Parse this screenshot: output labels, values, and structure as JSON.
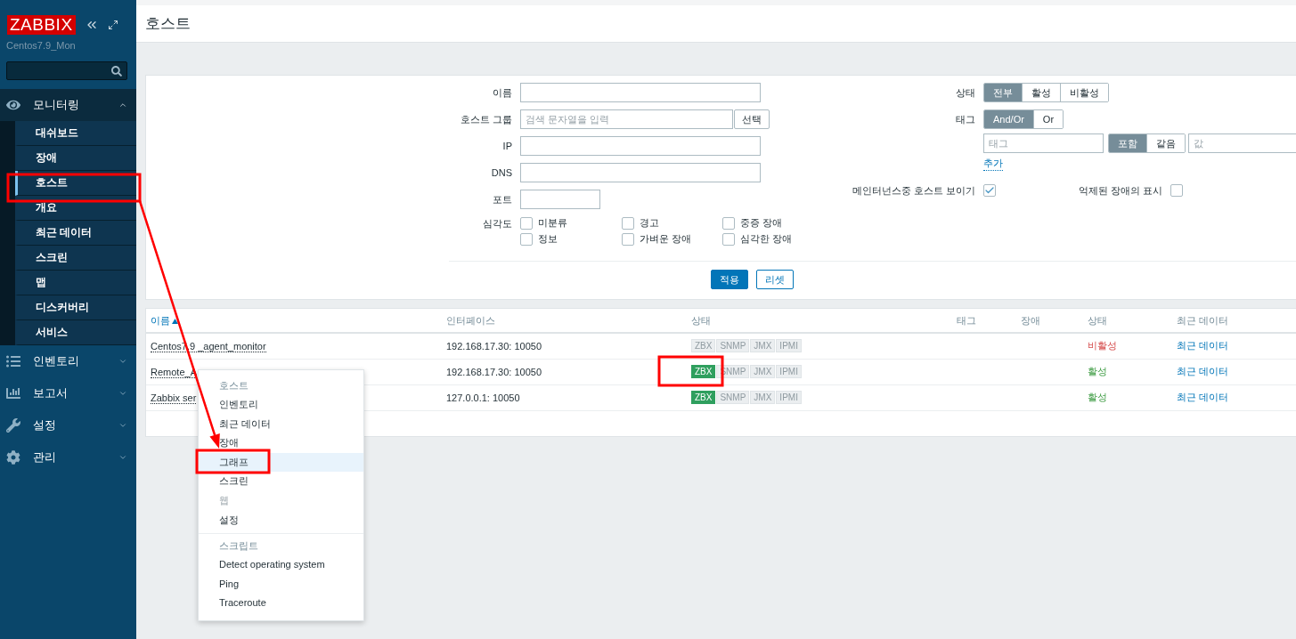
{
  "sidebar": {
    "logo": "ZABBIX",
    "server": "Centos7.9_Mon",
    "menu": [
      {
        "label": "모니터링",
        "expanded": true,
        "children": [
          {
            "label": "대쉬보드",
            "selected": false
          },
          {
            "label": "장애",
            "selected": false
          },
          {
            "label": "호스트",
            "selected": true
          },
          {
            "label": "개요",
            "selected": false
          },
          {
            "label": "최근 데이터",
            "selected": false
          },
          {
            "label": "스크린",
            "selected": false
          },
          {
            "label": "맵",
            "selected": false
          },
          {
            "label": "디스커버리",
            "selected": false
          },
          {
            "label": "서비스",
            "selected": false
          }
        ]
      },
      {
        "label": "인벤토리",
        "expanded": false
      },
      {
        "label": "보고서",
        "expanded": false
      },
      {
        "label": "설정",
        "expanded": false
      },
      {
        "label": "관리",
        "expanded": false
      }
    ]
  },
  "page_title": "호스트",
  "filter": {
    "fields": [
      {
        "label": "이름",
        "kind": "text"
      },
      {
        "label": "호스트 그룹",
        "kind": "multiselect",
        "placeholder": "검색 문자열을 입력",
        "button": "선택"
      },
      {
        "label": "IP",
        "kind": "text"
      },
      {
        "label": "DNS",
        "kind": "text"
      },
      {
        "label": "포트",
        "kind": "short"
      }
    ],
    "severity": {
      "label": "심각도",
      "options": [
        {
          "label": "미분류",
          "checked": false
        },
        {
          "label": "경고",
          "checked": false
        },
        {
          "label": "중증 장애",
          "checked": false
        },
        {
          "label": "정보",
          "checked": false
        },
        {
          "label": "가벼운 장애",
          "checked": false
        },
        {
          "label": "심각한 장애",
          "checked": false
        }
      ]
    },
    "status": {
      "label": "상태",
      "options": [
        {
          "label": "전부",
          "selected": true
        },
        {
          "label": "활성",
          "selected": false
        },
        {
          "label": "비활성",
          "selected": false
        }
      ]
    },
    "tags": {
      "label": "태그",
      "operators": [
        {
          "label": "And/Or",
          "selected": true
        },
        {
          "label": "Or",
          "selected": false
        }
      ],
      "tag_placeholder": "태그",
      "match": [
        {
          "label": "포함",
          "selected": true
        },
        {
          "label": "같음",
          "selected": false
        }
      ],
      "value_placeholder": "값",
      "add_link": "추가"
    },
    "maintenance": {
      "label": "메인터넌스중 호스트 보이기",
      "checked": true
    },
    "suppressed": {
      "label": "억제된 장애의 표시",
      "checked": false
    },
    "buttons": [
      {
        "label": "적용",
        "kind": "primary"
      },
      {
        "label": "리셋",
        "kind": "secondary"
      }
    ]
  },
  "table": {
    "columns": [
      {
        "label": "이름",
        "sorted": true
      },
      {
        "label": "인터페이스"
      },
      {
        "label": "상태"
      },
      {
        "label": "태그"
      },
      {
        "label": "장애"
      },
      {
        "label": "상태"
      },
      {
        "label": "최근 데이터"
      }
    ],
    "rows": [
      {
        "name": "Centos7.9 _agent_monitor",
        "interface": "192.168.17.30: 10050",
        "availability": [
          {
            "label": "ZBX",
            "available": false
          },
          {
            "label": "SNMP",
            "available": false
          },
          {
            "label": "JMX",
            "available": false
          },
          {
            "label": "IPMI",
            "available": false
          }
        ],
        "status": "비활성",
        "enabled": false,
        "latest": "최근 데이터"
      },
      {
        "name": "Remote_A",
        "interface": "192.168.17.30: 10050",
        "availability": [
          {
            "label": "ZBX",
            "available": true
          },
          {
            "label": "SNMP",
            "available": false
          },
          {
            "label": "JMX",
            "available": false
          },
          {
            "label": "IPMI",
            "available": false
          }
        ],
        "status": "활성",
        "enabled": true,
        "latest": "최근 데이터"
      },
      {
        "name": "Zabbix ser",
        "interface": "127.0.0.1: 10050",
        "availability": [
          {
            "label": "ZBX",
            "available": true
          },
          {
            "label": "SNMP",
            "available": false
          },
          {
            "label": "JMX",
            "available": false
          },
          {
            "label": "IPMI",
            "available": false
          }
        ],
        "status": "활성",
        "enabled": true,
        "latest": "최근 데이터"
      }
    ]
  },
  "context_menu": {
    "sections": [
      {
        "title": "호스트",
        "items": [
          {
            "label": "인벤토리",
            "disabled": false,
            "selected": false
          },
          {
            "label": "최근 데이터",
            "disabled": false,
            "selected": false
          },
          {
            "label": "장애",
            "disabled": false,
            "selected": false
          },
          {
            "label": "그래프",
            "disabled": false,
            "selected": true
          },
          {
            "label": "스크린",
            "disabled": false,
            "selected": false
          },
          {
            "label": "웹",
            "disabled": true,
            "selected": false
          },
          {
            "label": "설정",
            "disabled": false,
            "selected": false
          }
        ]
      },
      {
        "title": "스크립트",
        "items": [
          {
            "label": "Detect operating system",
            "disabled": false,
            "selected": false
          },
          {
            "label": "Ping",
            "disabled": false,
            "selected": false
          },
          {
            "label": "Traceroute",
            "disabled": false,
            "selected": false
          }
        ]
      }
    ]
  }
}
